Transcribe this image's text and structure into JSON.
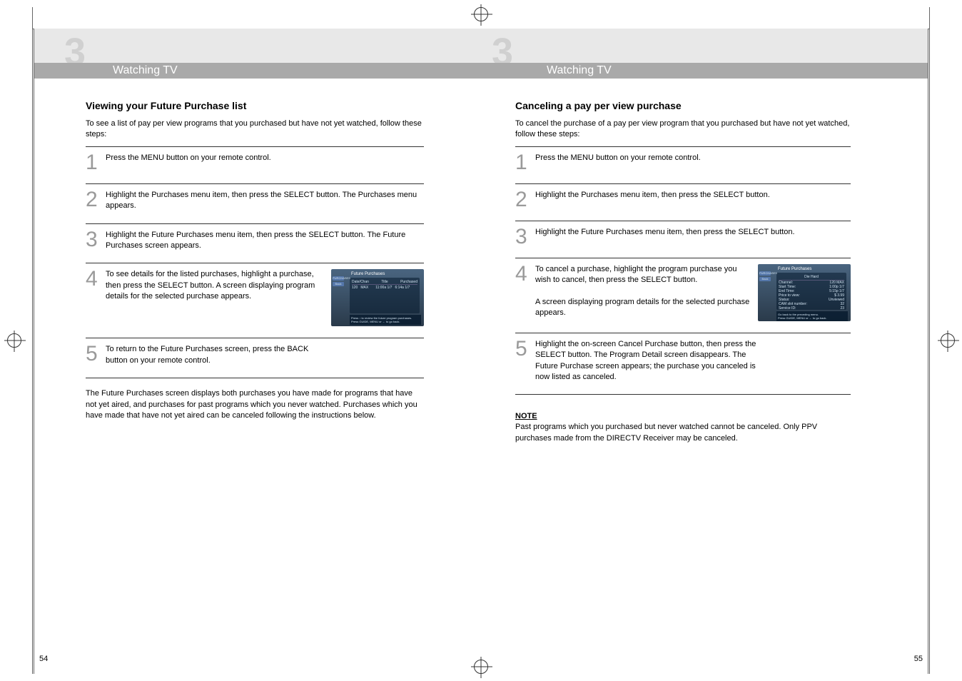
{
  "crop_marks": true,
  "left_page": {
    "chapter_number": "3",
    "chapter_title": "Watching TV",
    "section_title": "Viewing your Future Purchase list",
    "intro": "To see a list of pay per view programs that you purchased but have not yet watched, follow these steps:",
    "steps": [
      {
        "num": "1",
        "text": "Press the MENU button on your remote control."
      },
      {
        "num": "2",
        "text": "Highlight the Purchases menu item, then press the SELECT button. The Purchases menu appears."
      },
      {
        "num": "3",
        "text": "Highlight the Future Purchases menu item, then press the SELECT button. The Future Purchases screen appears."
      },
      {
        "num": "4",
        "text": "To see details for the listed purchases, highlight a purchase, then press the SELECT button. A screen displaying program details for the selected purchase appears.",
        "has_image": true
      },
      {
        "num": "5",
        "text": "To return to the Future Purchases screen, press the BACK button on your remote control."
      }
    ],
    "screenshot1": {
      "title": "Future Purchases",
      "sidebar_label": "PURCHASES",
      "back_button": "Back",
      "col1": "Date/Chan",
      "col2": "Title",
      "col3": "Purchased",
      "row_chan": "120",
      "row_title": "MAX",
      "row_start": "11:00a 1/7",
      "row_viewed": "6:14a 1/7",
      "footer1": "Press ↓ to review the future program purchases.",
      "footer2": "Press GUIDE, MENU or ← to go back."
    },
    "footer_text": "The Future Purchases screen displays both purchases you have made for programs that have not yet aired, and purchases for past programs which you never watched. Purchases which you  have made that have not yet aired can be canceled following the instructions below.",
    "page_number": "54"
  },
  "right_page": {
    "chapter_number": "3",
    "chapter_title": "Watching TV",
    "section_title": "Canceling a pay per view purchase",
    "intro": "To cancel the purchase of a pay per view program that you purchased but have not yet watched, follow these steps:",
    "steps": [
      {
        "num": "1",
        "text": "Press the MENU button on your remote control."
      },
      {
        "num": "2",
        "text": "Highlight the Purchases menu item, then press the SELECT button."
      },
      {
        "num": "3",
        "text": "Highlight the Future Purchases menu item, then press the SELECT button."
      },
      {
        "num": "4",
        "text": "To cancel a purchase, highlight the program purchase you wish to cancel, then press the SELECT button.",
        "text2": "A screen displaying program details for the selected purchase appears.",
        "has_image": true
      },
      {
        "num": "5",
        "text": "Highlight the on-screen Cancel Purchase button, then press the SELECT button. The Program Detail screen disappears. The Future Purchase screen appears; the purchase you canceled is now listed as canceled."
      }
    ],
    "screenshot2": {
      "title": "Future Purchases",
      "sidebar_label": "PURCHASES",
      "back_button": "Back",
      "heading": "Die Hard",
      "field1_label": "Channel:",
      "field1_value": "120 MAX",
      "field2_label": "Start Time:",
      "field2_value": "1:00p 1/7",
      "field3_label": "End Time:",
      "field3_value": "5:15p 1/7",
      "field4_label": "Price to view:",
      "field4_value": "$ 3.99",
      "field5_label": "Status:",
      "field5_value": "Unviewed",
      "field6_label": "CAM slot number:",
      "field6_value": "32",
      "field7_label": "Service ID:",
      "field7_value": "23",
      "footer1": "Go back to the preceding menu.",
      "footer2": "Press GUIDE, MENU or ← to go back."
    },
    "note_heading": "NOTE",
    "note_text": "Past programs which you purchased but never watched cannot be canceled. Only PPV purchases made from the DIRECTV Receiver may be canceled.",
    "page_number": "55"
  }
}
